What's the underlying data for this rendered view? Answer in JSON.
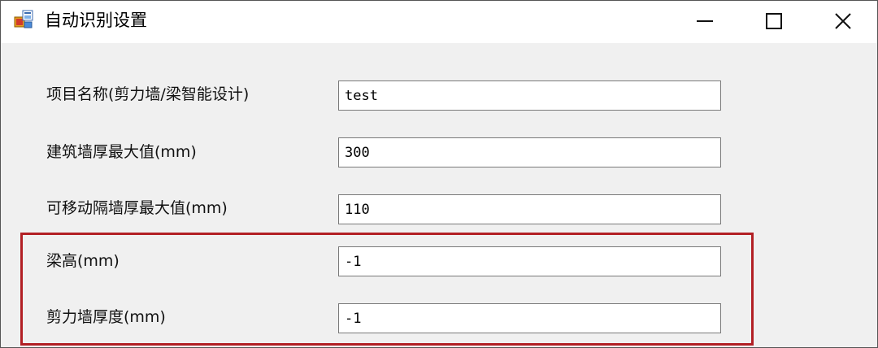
{
  "window": {
    "title": "自动识别设置",
    "app_icon": "winforms-app-icon",
    "controls": {
      "minimize_icon": "minimize-icon",
      "maximize_icon": "maximize-icon",
      "close_icon": "close-icon",
      "close_glyph": "✕"
    }
  },
  "form": {
    "fields": [
      {
        "label": "项目名称(剪力墙/梁智能设计)",
        "value": "test"
      },
      {
        "label": "建筑墙厚最大值(mm)",
        "value": "300"
      },
      {
        "label": "可移动隔墙厚最大值(mm)",
        "value": "110"
      },
      {
        "label": "梁高(mm)",
        "value": "-1"
      },
      {
        "label": "剪力墙厚度(mm)",
        "value": "-1"
      }
    ]
  },
  "colors": {
    "highlight_border": "#b21f24",
    "content_background": "#f0f0f0",
    "titlebar_background": "#ffffff"
  }
}
